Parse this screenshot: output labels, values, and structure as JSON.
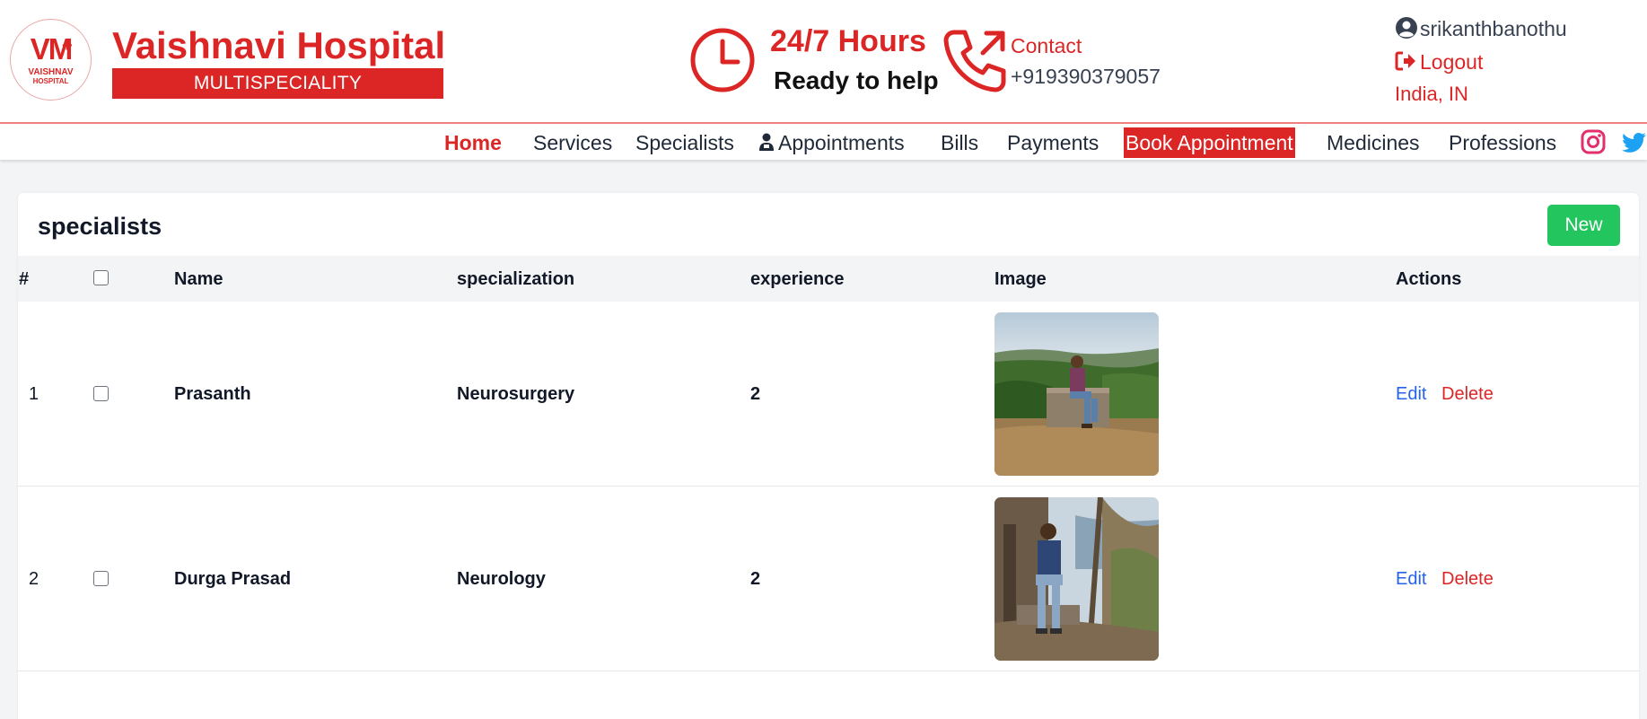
{
  "brand": {
    "logo_letters": "VM",
    "logo_line1": "VAISHNAV",
    "logo_line2": "HOSPITAL",
    "name": "Vaishnavi Hospital",
    "tagline": "MULTISPECIALITY"
  },
  "hours": {
    "title": "24/7 Hours",
    "subtitle": "Ready to help"
  },
  "contact": {
    "label": "Contact",
    "phone": "+919390379057"
  },
  "user": {
    "username": "srikanthbanothu",
    "logout_label": "Logout",
    "locale": "India, IN"
  },
  "nav": {
    "home": "Home",
    "services": "Services",
    "specialists": "Specialists",
    "appointments": "Appointments",
    "bills": "Bills",
    "payments": "Payments",
    "book_appointment": "Book Appointment",
    "medicines": "Medicines",
    "professions": "Professions"
  },
  "page": {
    "title": "specialists",
    "new_button": "New"
  },
  "table": {
    "columns": {
      "num": "#",
      "name": "Name",
      "specialization": "specialization",
      "experience": "experience",
      "image": "Image",
      "actions": "Actions"
    },
    "rows": [
      {
        "num": "1",
        "name": "Prasanth",
        "specialization": "Neurosurgery",
        "experience": "2",
        "edit": "Edit",
        "delete": "Delete"
      },
      {
        "num": "2",
        "name": "Durga Prasad",
        "specialization": "Neurology",
        "experience": "2",
        "edit": "Edit",
        "delete": "Delete"
      }
    ]
  },
  "colors": {
    "brand_red": "#dc2626",
    "new_green": "#22c55e",
    "edit_blue": "#2563eb",
    "instagram": "#e1306c",
    "twitter": "#1da1f2"
  },
  "icons": [
    "clock-icon",
    "phone-icon",
    "user-circle-icon",
    "logout-icon",
    "doctor-icon",
    "instagram-icon",
    "twitter-icon"
  ]
}
